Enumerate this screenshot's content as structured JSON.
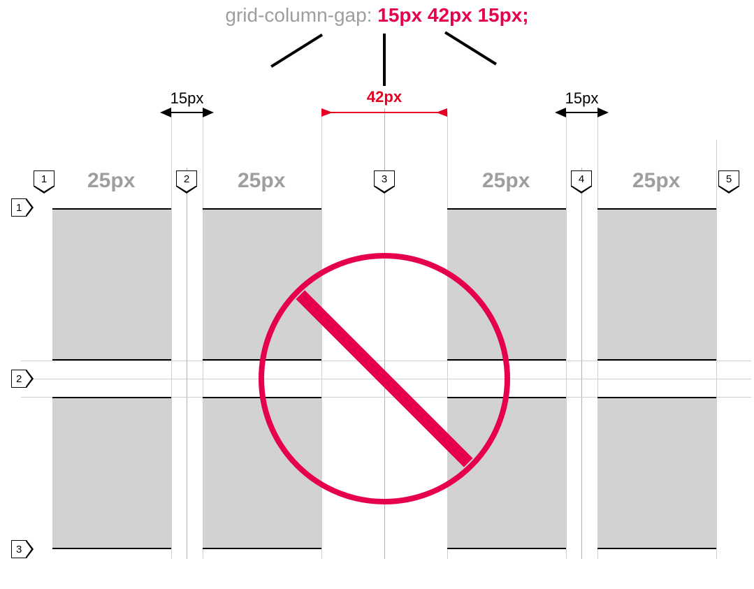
{
  "title": {
    "property": "grid-column-gap:",
    "values": "15px 42px 15px;"
  },
  "gaps": [
    {
      "label": "15px",
      "color": "black"
    },
    {
      "label": "42px",
      "color": "red"
    },
    {
      "label": "15px",
      "color": "black"
    }
  ],
  "column_size_labels": [
    "25px",
    "25px",
    "25px",
    "25px"
  ],
  "column_line_numbers": [
    "1",
    "2",
    "3",
    "4",
    "5"
  ],
  "row_line_numbers": [
    "1",
    "2",
    "3"
  ],
  "colors": {
    "accent": "#e6004c",
    "muted": "#9e9e9e",
    "cell": "#d2d2d2"
  },
  "diagram": {
    "columns": 4,
    "rows": 2,
    "column_width_label": "25px",
    "row_gap_implied": true,
    "invalid_syntax": true
  }
}
